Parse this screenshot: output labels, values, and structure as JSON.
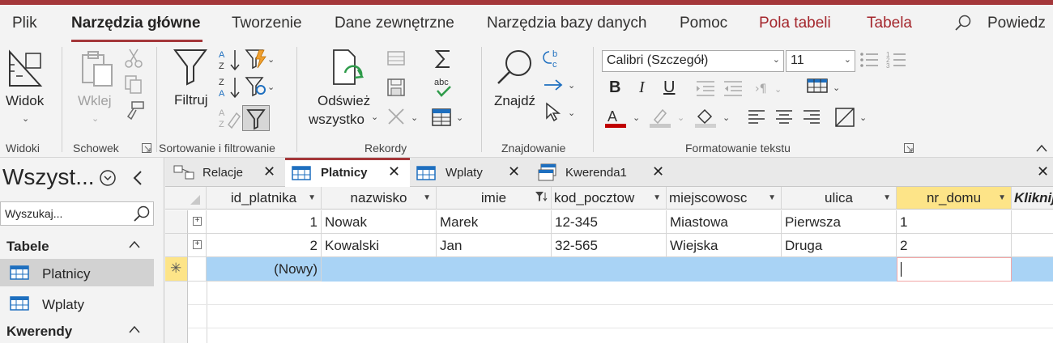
{
  "menu": {
    "tabs": [
      {
        "label": "Plik"
      },
      {
        "label": "Narzędzia główne"
      },
      {
        "label": "Tworzenie"
      },
      {
        "label": "Dane zewnętrzne"
      },
      {
        "label": "Narzędzia bazy danych"
      },
      {
        "label": "Pomoc"
      },
      {
        "label": "Pola tabeli"
      },
      {
        "label": "Tabela"
      }
    ],
    "search_label": "Powiedz"
  },
  "ribbon": {
    "groups": {
      "widoki": "Widoki",
      "schowek": "Schowek",
      "sortowanie": "Sortowanie i filtrowanie",
      "rekordy": "Rekordy",
      "znajdowanie": "Znajdowanie",
      "formatowanie": "Formatowanie tekstu"
    },
    "buttons": {
      "widok": "Widok",
      "wklej": "Wklej",
      "filtruj": "Filtruj",
      "odswiez_1": "Odśwież",
      "odswiez_2": "wszystko",
      "znajdz": "Znajdź"
    },
    "font_name": "Calibri (Szczegół)",
    "font_size": "11",
    "colors": {
      "font_color": "#c00000",
      "accent": "#a4373a"
    }
  },
  "nav": {
    "title": "Wszyst...",
    "search_placeholder": "Wyszukaj...",
    "sections": [
      {
        "label": "Tabele",
        "items": [
          {
            "label": "Platnicy"
          },
          {
            "label": "Wplaty"
          }
        ]
      },
      {
        "label": "Kwerendy",
        "items": []
      }
    ]
  },
  "doc_tabs": [
    {
      "label": "Relacje"
    },
    {
      "label": "Platnicy"
    },
    {
      "label": "Wplaty"
    },
    {
      "label": "Kwerenda1"
    }
  ],
  "table": {
    "columns": [
      "id_platnika",
      "nazwisko",
      "imie",
      "kod_pocztow",
      "miejscowosc",
      "ulica",
      "nr_domu",
      "Kliknij"
    ],
    "rows": [
      [
        "1",
        "Nowak",
        "Marek",
        "12-345",
        "Miastowa",
        "Pierwsza",
        "1"
      ],
      [
        "2",
        "Kowalski",
        "Jan",
        "32-565",
        "Wiejska",
        "Druga",
        "2"
      ]
    ],
    "new_row_label": "(Nowy)"
  }
}
